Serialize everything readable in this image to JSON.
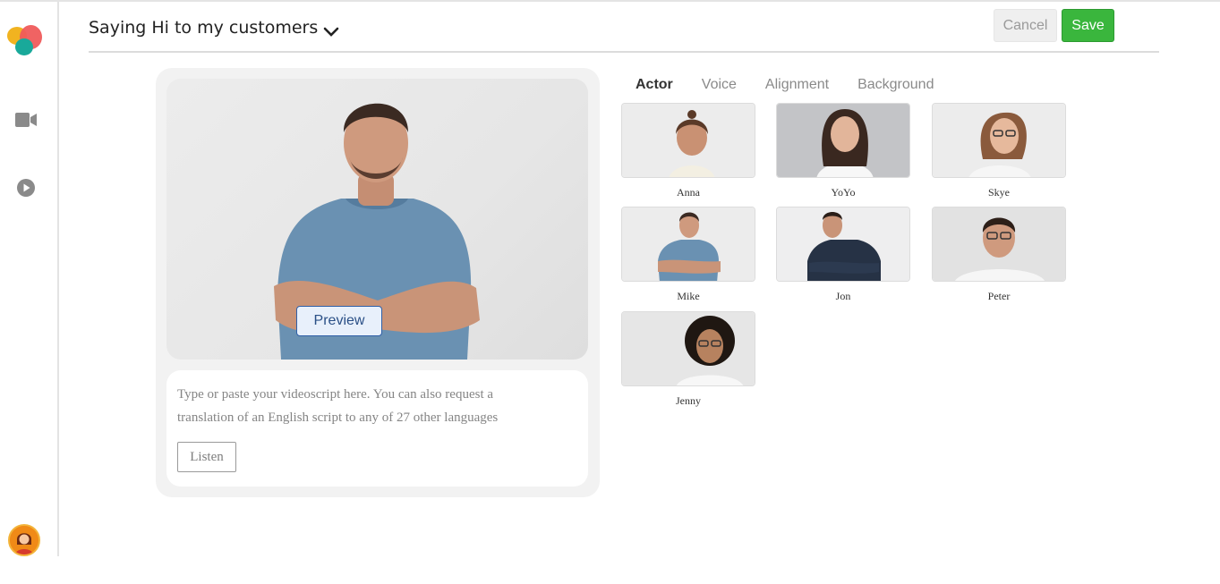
{
  "header": {
    "title": "Saying Hi to my customers",
    "cancel_label": "Cancel",
    "save_label": "Save"
  },
  "sidebar": {
    "items": [
      {
        "icon": "video-camera-icon"
      },
      {
        "icon": "play-circle-icon"
      }
    ]
  },
  "editor": {
    "preview_label": "Preview",
    "script_placeholder": "Type or paste your videoscript here. You can also request a translation of an English script to any of 27 other languages",
    "listen_label": "Listen"
  },
  "tabs": [
    "Actor",
    "Voice",
    "Alignment",
    "Background"
  ],
  "actors": [
    "Anna",
    "YoYo",
    "Skye",
    "Mike",
    "Jon",
    "Peter",
    "Jenny"
  ],
  "colors": {
    "save": "#3ab63d",
    "preview_border": "#2f5fa7",
    "logo_yellow": "#f1b320",
    "logo_red": "#ef5b5b",
    "logo_teal": "#19a99a"
  }
}
